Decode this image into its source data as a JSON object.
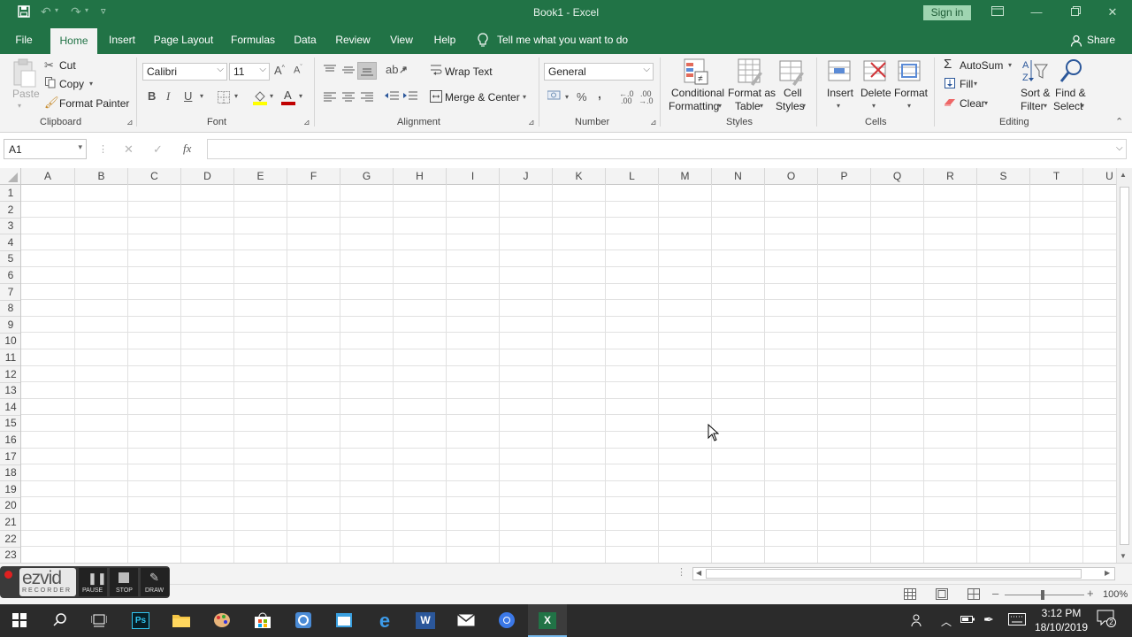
{
  "window": {
    "title": "Book1  -  Excel",
    "sign_in": "Sign in",
    "share": "Share"
  },
  "tabs": [
    {
      "label": "File",
      "active": false
    },
    {
      "label": "Home",
      "active": true
    },
    {
      "label": "Insert",
      "active": false
    },
    {
      "label": "Page Layout",
      "active": false
    },
    {
      "label": "Formulas",
      "active": false
    },
    {
      "label": "Data",
      "active": false
    },
    {
      "label": "Review",
      "active": false
    },
    {
      "label": "View",
      "active": false
    },
    {
      "label": "Help",
      "active": false
    }
  ],
  "tell_me": "Tell me what you want to do",
  "ribbon": {
    "clipboard": {
      "paste": "Paste",
      "cut": "Cut",
      "copy": "Copy",
      "format_painter": "Format Painter",
      "label": "Clipboard"
    },
    "font": {
      "family": "Calibri",
      "size": "11",
      "label": "Font",
      "bold": "B",
      "italic": "I",
      "underline": "U"
    },
    "alignment": {
      "wrap_text": "Wrap Text",
      "merge_center": "Merge & Center",
      "label": "Alignment"
    },
    "number": {
      "format": "General",
      "percent": "%",
      "comma": ",",
      "label": "Number"
    },
    "styles": {
      "conditional_1": "Conditional",
      "conditional_2": "Formatting",
      "format_table_1": "Format as",
      "format_table_2": "Table",
      "cell_styles_1": "Cell",
      "cell_styles_2": "Styles",
      "label": "Styles"
    },
    "cells": {
      "insert": "Insert",
      "delete": "Delete",
      "format": "Format",
      "label": "Cells"
    },
    "editing": {
      "autosum": "AutoSum",
      "fill": "Fill",
      "clear": "Clear",
      "sort_1": "Sort &",
      "sort_2": "Filter",
      "find_1": "Find &",
      "find_2": "Select",
      "label": "Editing"
    }
  },
  "formula_bar": {
    "name_box": "A1",
    "fx": "fx",
    "cancel": "✕",
    "enter": "✓",
    "value": ""
  },
  "columns": [
    "A",
    "B",
    "C",
    "D",
    "E",
    "F",
    "G",
    "H",
    "I",
    "J",
    "K",
    "L",
    "M",
    "N",
    "O",
    "P",
    "Q",
    "R",
    "S",
    "T",
    "U"
  ],
  "rows": [
    "1",
    "2",
    "3",
    "4",
    "5",
    "6",
    "7",
    "8",
    "9",
    "10",
    "11",
    "12",
    "13",
    "14",
    "15",
    "16",
    "17",
    "18",
    "19",
    "20",
    "21",
    "22",
    "23"
  ],
  "status": {
    "zoom": "100%"
  },
  "ezvid": {
    "brand": "ezvid",
    "sub": "RECORDER",
    "pause": "PAUSE",
    "stop": "STOP",
    "draw": "DRAW"
  },
  "taskbar": {
    "time": "3:12 PM",
    "date": "18/10/2019",
    "notifications": "2"
  },
  "colors": {
    "excel_green": "#217346",
    "ribbon_bg": "#f3f3f3",
    "grid_line": "#e1e1e1",
    "taskbar": "#2b2b2b"
  }
}
